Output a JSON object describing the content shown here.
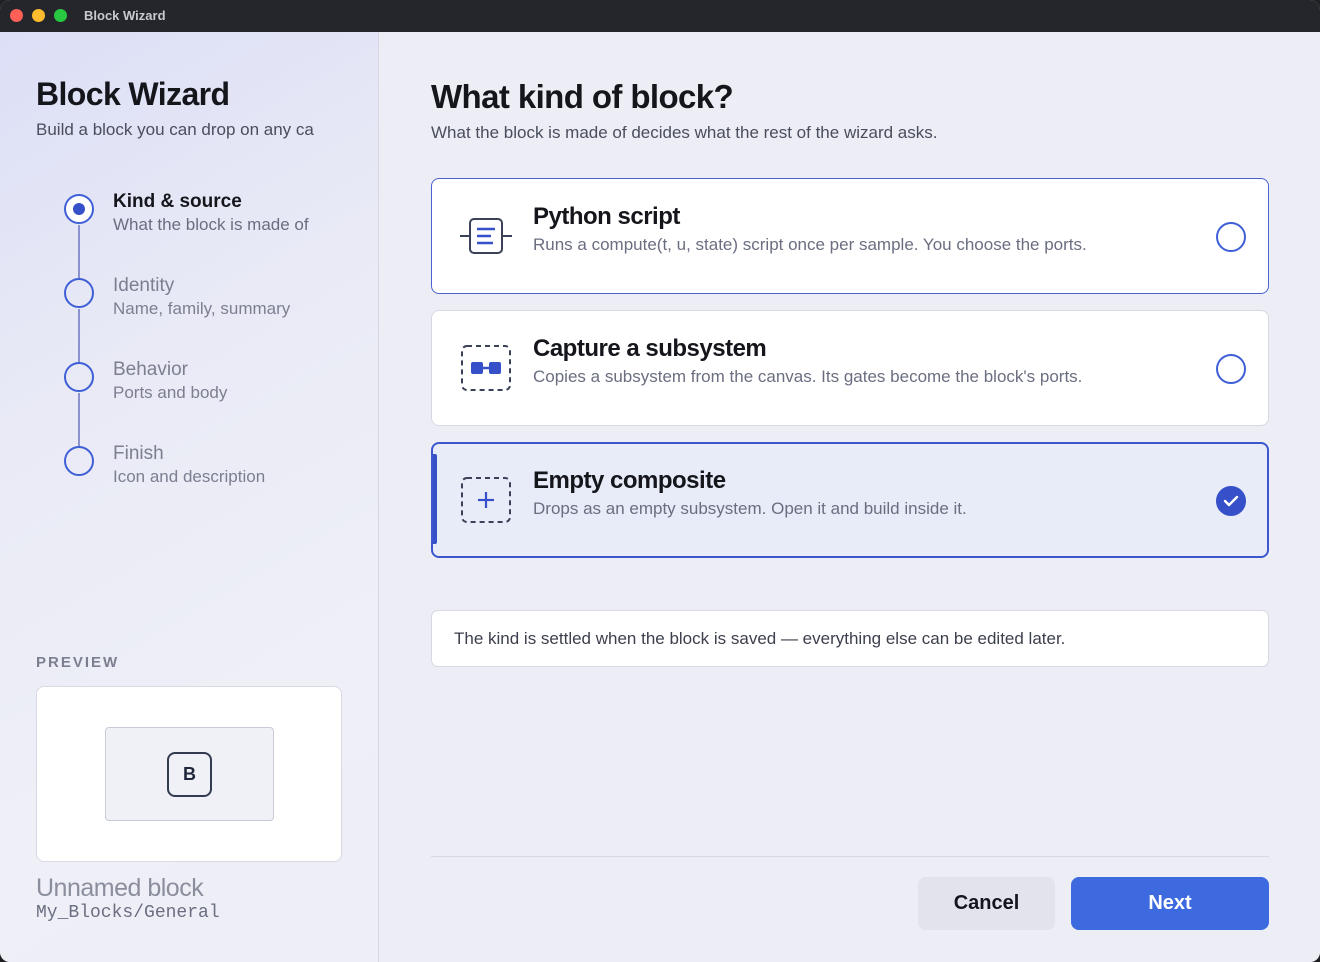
{
  "window": {
    "title": "Block Wizard",
    "controls": [
      "close",
      "minimize",
      "maximize"
    ]
  },
  "sidebar": {
    "title": "Block Wizard",
    "subtitle": "Build a block you can drop on any ca",
    "steps": [
      {
        "label": "Kind & source",
        "description": "What the block is made of",
        "state": "active"
      },
      {
        "label": "Identity",
        "description": "Name, family, summary",
        "state": "pending"
      },
      {
        "label": "Behavior",
        "description": "Ports and body",
        "state": "pending"
      },
      {
        "label": "Finish",
        "description": "Icon and description",
        "state": "pending"
      }
    ],
    "preview": {
      "heading": "PREVIEW",
      "glyph": "B",
      "name": "Unnamed block",
      "path": "My_Blocks/General"
    }
  },
  "main": {
    "title": "What kind of block?",
    "subtitle": "What the block is made of decides what the rest of the wizard asks.",
    "options": [
      {
        "title": "Python script",
        "description": "Runs a compute(t, u, state) script once per sample. You choose the ports.",
        "icon": "script-icon",
        "selected": false
      },
      {
        "title": "Capture a subsystem",
        "description": "Copies a subsystem from the canvas. Its gates become the block's ports.",
        "icon": "subsystem-icon",
        "selected": false
      },
      {
        "title": "Empty composite",
        "description": "Drops as an empty subsystem. Open it and build inside it.",
        "icon": "composite-plus-icon",
        "selected": true
      }
    ],
    "note": "The kind is settled when the block is saved — everything else can be edited later."
  },
  "footer": {
    "cancel_label": "Cancel",
    "next_label": "Next"
  },
  "colors": {
    "accent": "#3550c8",
    "primary_button": "#3e6ae0",
    "selected_card": "#e8ebf8"
  }
}
